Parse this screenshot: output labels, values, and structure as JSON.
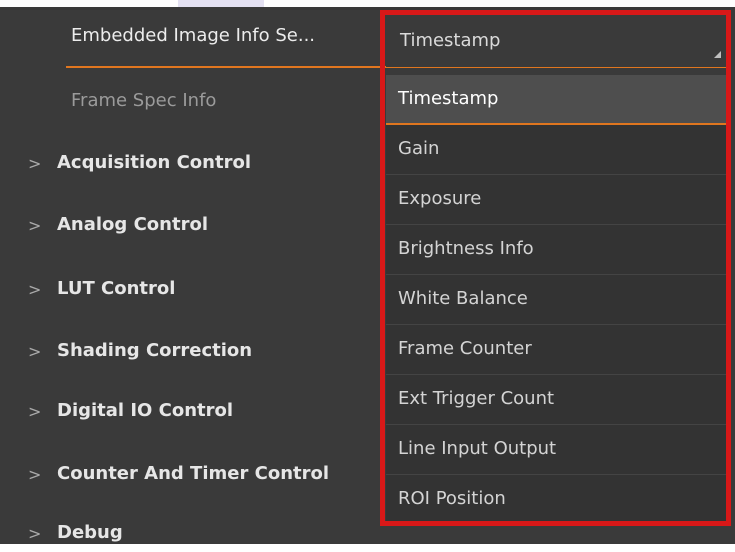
{
  "parameter_row": {
    "label": "Embedded Image Info Se...",
    "value": "Timestamp"
  },
  "frame_spec": {
    "label": "Frame Spec Info"
  },
  "categories": [
    {
      "label": "Acquisition Control",
      "chevron": ">"
    },
    {
      "label": "Analog Control",
      "chevron": ">"
    },
    {
      "label": "LUT Control",
      "chevron": ">"
    },
    {
      "label": "Shading Correction",
      "chevron": ">"
    },
    {
      "label": "Digital IO Control",
      "chevron": ">"
    },
    {
      "label": "Counter And Timer Control",
      "chevron": ">"
    },
    {
      "label": "Debug",
      "chevron": ">"
    }
  ],
  "dropdown": {
    "selected": "Timestamp",
    "options": [
      "Timestamp",
      "Gain",
      "Exposure",
      "Brightness Info",
      "White Balance",
      "Frame Counter",
      "Ext Trigger Count",
      "Line Input Output",
      "ROI Position"
    ]
  },
  "colors": {
    "panel_background": "#3a3a3a",
    "accent_orange": "#e0761f",
    "highlight_red": "#d81818"
  }
}
